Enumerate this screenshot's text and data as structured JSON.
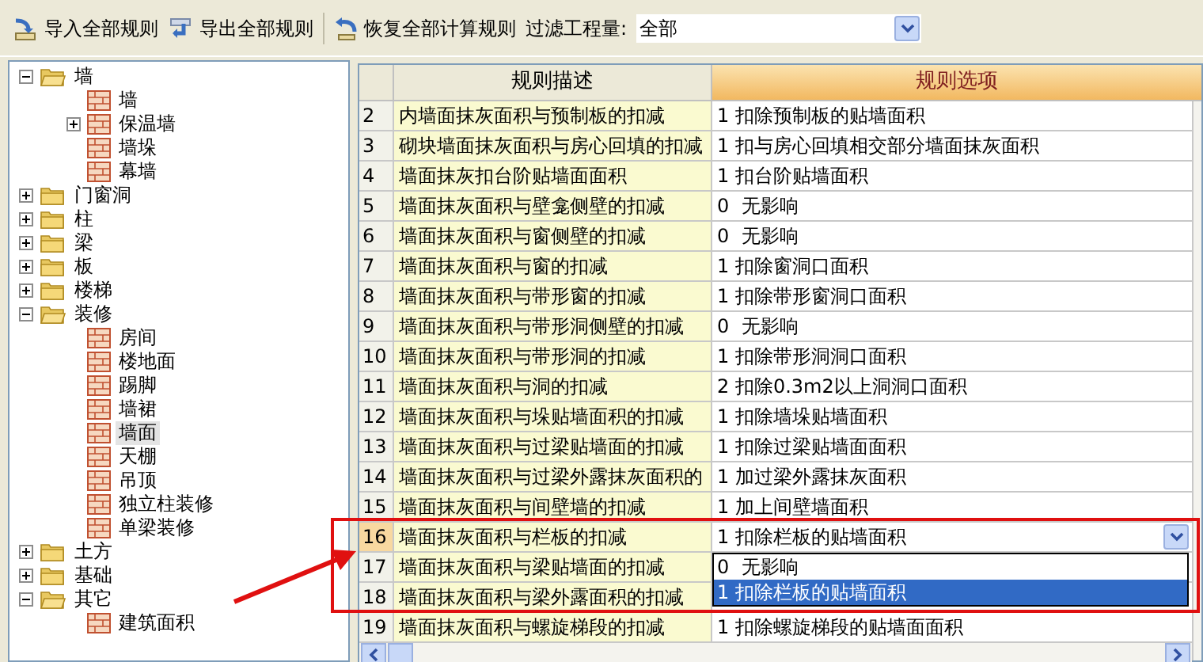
{
  "toolbar": {
    "buttons": [
      {
        "label": "导入全部规则",
        "kind": "import"
      },
      {
        "label": "导出全部规则",
        "kind": "export"
      },
      {
        "label": "恢复全部计算规则",
        "kind": "restore"
      }
    ],
    "filter": {
      "label": "过滤工程量:",
      "value": "全部"
    }
  },
  "tree": [
    {
      "label": "墙",
      "kind": "folder",
      "expanded": true,
      "children": [
        {
          "label": "墙",
          "kind": "item",
          "selected": false
        },
        {
          "label": "保温墙",
          "kind": "item",
          "expanded": false,
          "selected": false
        },
        {
          "label": "墙垛",
          "kind": "item",
          "selected": false
        },
        {
          "label": "幕墙",
          "kind": "item",
          "selected": false
        }
      ]
    },
    {
      "label": "门窗洞",
      "kind": "folder",
      "expanded": false
    },
    {
      "label": "柱",
      "kind": "folder",
      "expanded": false
    },
    {
      "label": "梁",
      "kind": "folder",
      "expanded": false
    },
    {
      "label": "板",
      "kind": "folder",
      "expanded": false
    },
    {
      "label": "楼梯",
      "kind": "folder",
      "expanded": false
    },
    {
      "label": "装修",
      "kind": "folder",
      "expanded": true,
      "children": [
        {
          "label": "房间",
          "kind": "item",
          "selected": false
        },
        {
          "label": "楼地面",
          "kind": "item",
          "selected": false
        },
        {
          "label": "踢脚",
          "kind": "item",
          "selected": false
        },
        {
          "label": "墙裙",
          "kind": "item",
          "selected": false
        },
        {
          "label": "墙面",
          "kind": "item",
          "selected": true
        },
        {
          "label": "天棚",
          "kind": "item",
          "selected": false
        },
        {
          "label": "吊顶",
          "kind": "item",
          "selected": false
        },
        {
          "label": "独立柱装修",
          "kind": "item",
          "selected": false
        },
        {
          "label": "单梁装修",
          "kind": "item",
          "selected": false
        }
      ]
    },
    {
      "label": "土方",
      "kind": "folder",
      "expanded": false
    },
    {
      "label": "基础",
      "kind": "folder",
      "expanded": false
    },
    {
      "label": "其它",
      "kind": "folder",
      "expanded": true,
      "children": [
        {
          "label": "建筑面积",
          "kind": "item",
          "selected": false
        }
      ]
    }
  ],
  "table": {
    "columns": [
      "规则描述",
      "规则选项"
    ],
    "rows": [
      {
        "number": "2",
        "description": "内墙面抹灰面积与预制板的扣减",
        "option": "1 扣除预制板的贴墙面积",
        "selected": false
      },
      {
        "number": "3",
        "description": "砌块墙面抹灰面积与房心回填的扣减",
        "option": "1 扣与房心回填相交部分墙面抹灰面积",
        "selected": false
      },
      {
        "number": "4",
        "description": "墙面抹灰扣台阶贴墙面面积",
        "option": "1 扣台阶贴墙面积",
        "selected": false
      },
      {
        "number": "5",
        "description": "墙面抹灰面积与壁龛侧壁的扣减",
        "option": "0  无影响",
        "selected": false
      },
      {
        "number": "6",
        "description": "墙面抹灰面积与窗侧壁的扣减",
        "option": "0  无影响",
        "selected": false
      },
      {
        "number": "7",
        "description": "墙面抹灰面积与窗的扣减",
        "option": "1 扣除窗洞口面积",
        "selected": false
      },
      {
        "number": "8",
        "description": "墙面抹灰面积与带形窗的扣减",
        "option": "1 扣除带形窗洞口面积",
        "selected": false
      },
      {
        "number": "9",
        "description": "墙面抹灰面积与带形洞侧壁的扣减",
        "option": "0  无影响",
        "selected": false
      },
      {
        "number": "10",
        "description": "墙面抹灰面积与带形洞的扣减",
        "option": "1 扣除带形洞洞口面积",
        "selected": false
      },
      {
        "number": "11",
        "description": "墙面抹灰面积与洞的扣减",
        "option": "2 扣除0.3m2以上洞洞口面积",
        "selected": false
      },
      {
        "number": "12",
        "description": "墙面抹灰面积与垛贴墙面积的扣减",
        "option": "1 扣除墙垛贴墙面积",
        "selected": false
      },
      {
        "number": "13",
        "description": "墙面抹灰面积与过梁贴墙面的扣减",
        "option": "1 扣除过梁贴墙面面积",
        "selected": false
      },
      {
        "number": "14",
        "description": "墙面抹灰面积与过梁外露抹灰面积的",
        "option": "1 加过梁外露抹灰面积",
        "selected": false
      },
      {
        "number": "15",
        "description": "墙面抹灰面积与间壁墙的扣减",
        "option": "1 加上间壁墙面积",
        "selected": false
      },
      {
        "number": "16",
        "description": "墙面抹灰面积与栏板的扣减",
        "option": "1 扣除栏板的贴墙面积",
        "selected": true,
        "dropdown": [
          {
            "label": "0  无影响",
            "selected": false
          },
          {
            "label": "1 扣除栏板的贴墙面积",
            "selected": true
          }
        ]
      },
      {
        "number": "17",
        "description": "墙面抹灰面积与梁贴墙面的扣减",
        "selected": false
      },
      {
        "number": "18",
        "description": "墙面抹灰面积与梁外露面积的扣减",
        "selected": false
      },
      {
        "number": "19",
        "description": "墙面抹灰面积与螺旋梯段的扣减",
        "option": "1 扣除螺旋梯段的贴墙面面积",
        "selected": false
      }
    ]
  }
}
